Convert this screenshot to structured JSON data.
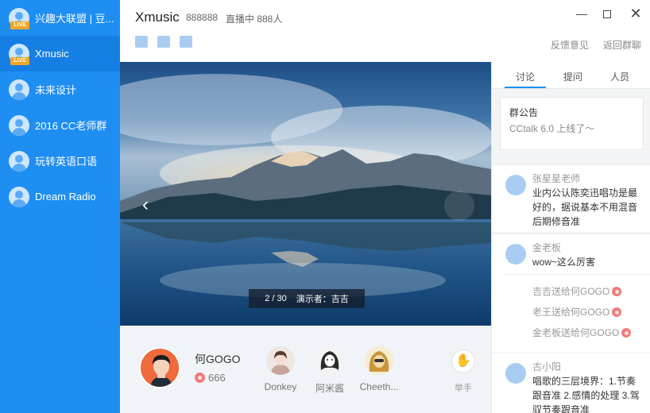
{
  "sidebar": {
    "items": [
      {
        "label": "兴趣大联盟 | 豆...",
        "live": true,
        "live_label": "LIVE"
      },
      {
        "label": "Xmusic",
        "live": true,
        "live_label": "LIVE",
        "active": true
      },
      {
        "label": "未来设计",
        "live": false
      },
      {
        "label": "2016 CC老师群",
        "live": false
      },
      {
        "label": "玩转英语口语",
        "live": false
      },
      {
        "label": "Dream Radio",
        "live": false
      }
    ]
  },
  "header": {
    "title": "Xmusic",
    "room_id": "888888",
    "live_status": "直播中 888人",
    "feedback": "反馈意见",
    "back": "返回群聊"
  },
  "stage": {
    "page_indicator": "2 / 30",
    "presenter": "演示者：吉吉"
  },
  "host": {
    "name": "何GOGO",
    "likes": "666"
  },
  "members": [
    {
      "name": "Donkey"
    },
    {
      "name": "阿米酱"
    },
    {
      "name": "Cheeth..."
    }
  ],
  "raise_hand": "举手",
  "panel": {
    "tabs": [
      "讨论",
      "提问",
      "人员"
    ],
    "notice_title": "群公告",
    "notice_body": "CCtalk 6.0 上线了～",
    "messages": [
      {
        "name": "张星星老师",
        "text": "业内公认陈奕迅唱功是最好的，据说基本不用混音后期修音准"
      },
      {
        "name": "金老板",
        "text": "wow~这么厉害"
      },
      {
        "name": "古小阳",
        "text": "唱歌的三层境界：1.节奏跟音准 2.感情的处理 3.驾驭节奏跟音准"
      }
    ],
    "gifts": [
      "吉吉送给何GOGO",
      "老王送给何GOGO",
      "金老板送给何GOGO"
    ]
  },
  "colors": {
    "sidebar": "#1e8ef3",
    "accent": "#1e8ef3",
    "live_badge": "#f5a623"
  }
}
